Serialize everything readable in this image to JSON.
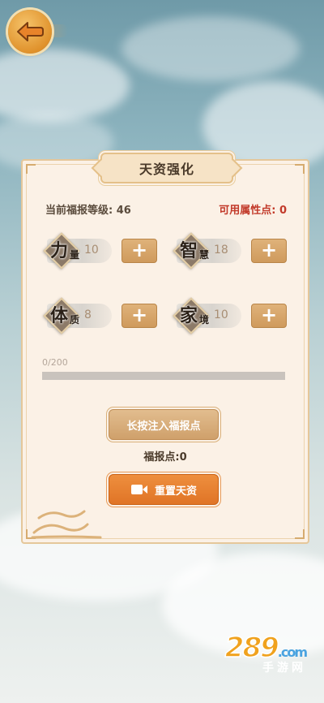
{
  "header": {
    "back_icon": "back-arrow-icon"
  },
  "panel": {
    "title": "天资强化",
    "level_text": "当前福报等级: 46",
    "available_text": "可用属性点: 0"
  },
  "stats": [
    {
      "big": "力",
      "small": "量",
      "value": "10"
    },
    {
      "big": "智",
      "small": "慧",
      "value": "18"
    },
    {
      "big": "体",
      "small": "质",
      "value": "8"
    },
    {
      "big": "家",
      "small": "境",
      "value": "10"
    }
  ],
  "plus_label": "+",
  "progress": {
    "label": "0/200",
    "fraction": 0
  },
  "inject_button": "长按注入福报点",
  "points_text": "福报点:0",
  "reset_button": "重置天资",
  "watermark": {
    "logo": "289",
    "dotcom": ".com",
    "sub": "手游网"
  },
  "colors": {
    "accent": "#e07426",
    "gold": "#cfa06b",
    "red": "#c23a2a"
  }
}
